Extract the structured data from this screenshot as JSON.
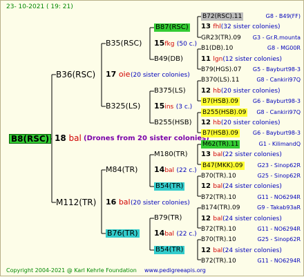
{
  "header": {
    "date_text": "23- 10-2021 ( 19: 21)"
  },
  "footer": {
    "copyright": "Copyright 2004-2021 @ Karl Kehrle Foundation",
    "website": "www.pedigreeapis.org"
  },
  "colors": {
    "green_box": "#33cc33",
    "cyan_box": "#33cccc",
    "yellow_box": "#ffff33",
    "grey_box": "#bbbbbb",
    "background": "#fdfde8"
  },
  "root": {
    "name": "B8(RSC)",
    "count": "18",
    "code": "bal",
    "note": "(Drones from 20 sister colonies)"
  },
  "l1": {
    "top": {
      "name": "B36(RSC)",
      "count": "17",
      "code": "oie",
      "note": "(20 sister colonies)"
    },
    "bottom": {
      "name": "M112(TR)",
      "count": "16",
      "code": "bal",
      "note": "(20 sister colonies)"
    }
  },
  "l2": [
    {
      "name": "B35(RSC)",
      "count": "15",
      "code": "fkg",
      "note": "(50 c.)"
    },
    {
      "name": "B325(LS)",
      "count": "15",
      "code": "ins",
      "note": "(3 c.)"
    },
    {
      "name": "M84(TR)",
      "count": "14",
      "code": "bal",
      "note": "(22 c.)"
    },
    {
      "name": "B76(TR)",
      "count": "14",
      "code": "bal",
      "note": "(22 c.)"
    }
  ],
  "l3": [
    {
      "name": "B87(RSC)"
    },
    {
      "name": "B49(DB)"
    },
    {
      "name": "B375(LS)"
    },
    {
      "name": "B255(HSB)"
    },
    {
      "name": "M180(TR)"
    },
    {
      "name": "B54(TR)"
    },
    {
      "name": "B79(TR)"
    },
    {
      "name": "B54(TR)"
    }
  ],
  "l4": [
    {
      "name": "B72(RSC).11",
      "id": "G8 - B49(FF)"
    },
    {
      "count": "13",
      "code": "fhl",
      "note": "(32 sister colonies)"
    },
    {
      "name": "GR23(TR).09",
      "id": "G3 - Gr.R.mounta"
    },
    {
      "name": "B1(DB).10",
      "id": "G8 - MG00R"
    },
    {
      "count": "11",
      "code": "lgn",
      "note": "(12 sister colonies)"
    },
    {
      "name": "B79(HGS).07",
      "id": "G5 - Bayburt98-3"
    },
    {
      "name": "B370(LS).11",
      "id": "G8 - Cankiri97Q"
    },
    {
      "count": "12",
      "code": "hb",
      "note": "(20 sister colonies)"
    },
    {
      "name": "B7(HSB).09",
      "id": "G6 - Bayburt98-3"
    },
    {
      "name": "B255(HSB).09",
      "id": "G8 - Cankiri97Q"
    },
    {
      "count": "12",
      "code": "hb",
      "note": "(20 sister colonies)"
    },
    {
      "name": "B7(HSB).09",
      "id": "G6 - Bayburt98-3"
    },
    {
      "name": "M62(TR).11",
      "id": "G1 - KilimandQ"
    },
    {
      "count": "13",
      "code": "bal",
      "note": "(22 sister colonies)"
    },
    {
      "name": "B47(MKK).09",
      "id": "G23 - Sinop62R"
    },
    {
      "name": "B70(TR).10",
      "id": "G25 - Sinop62R"
    },
    {
      "count": "12",
      "code": "bal",
      "note": "(24 sister colonies)"
    },
    {
      "name": "B72(TR).10",
      "id": "G11 - NO6294R"
    },
    {
      "name": "B174(TR).09",
      "id": "G9 - Takab93aR"
    },
    {
      "count": "12",
      "code": "bal",
      "note": "(24 sister colonies)"
    },
    {
      "name": "B72(TR).10",
      "id": "G11 - NO6294R"
    },
    {
      "name": "B70(TR).10",
      "id": "G25 - Sinop62R"
    },
    {
      "count": "12",
      "code": "bal",
      "note": "(24 sister colonies)"
    },
    {
      "name": "B72(TR).10",
      "id": "G11 - NO6294R"
    }
  ]
}
